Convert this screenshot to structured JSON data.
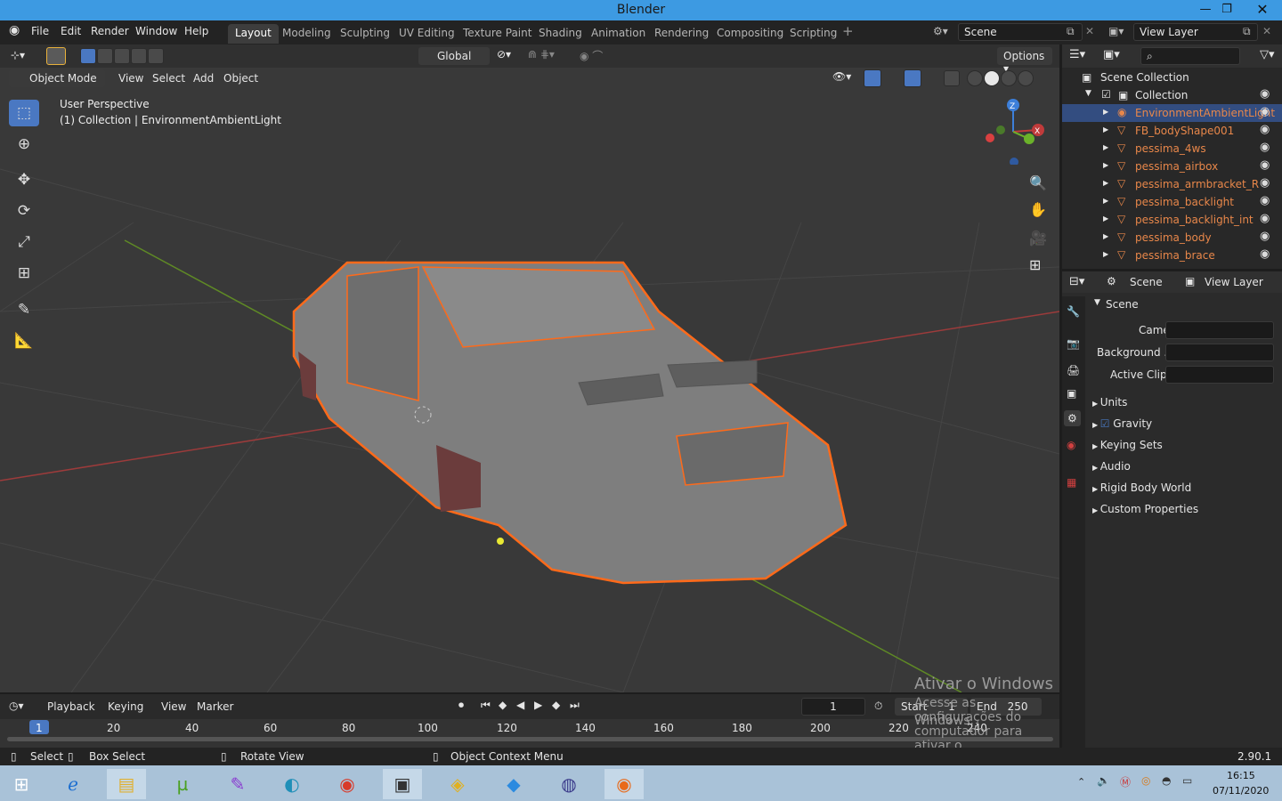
{
  "window": {
    "title": "Blender"
  },
  "menu": {
    "items": [
      "File",
      "Edit",
      "Render",
      "Window",
      "Help"
    ]
  },
  "workspaces": [
    "Layout",
    "Modeling",
    "Sculpting",
    "UV Editing",
    "Texture Paint",
    "Shading",
    "Animation",
    "Rendering",
    "Compositing",
    "Scripting"
  ],
  "active_workspace": "Layout",
  "scene": {
    "name": "Scene",
    "view_layer": "View Layer"
  },
  "toolbar": {
    "orientation": "Global",
    "options": "Options"
  },
  "header": {
    "mode": "Object Mode",
    "items": [
      "View",
      "Select",
      "Add",
      "Object"
    ]
  },
  "viewport": {
    "perspective": "User Perspective",
    "collection_info": "(1) Collection | EnvironmentAmbientLight"
  },
  "outliner": {
    "root": "Scene Collection",
    "collection": "Collection",
    "objects": [
      "EnvironmentAmbientLight",
      "FB_bodyShape001",
      "pessima_4ws",
      "pessima_airbox",
      "pessima_armbracket_R",
      "pessima_backlight",
      "pessima_backlight_int",
      "pessima_body",
      "pessima_brace"
    ]
  },
  "properties": {
    "tabs": {
      "scene": "Scene",
      "view_layer": "View Layer"
    },
    "panel_title": "Scene",
    "fields": [
      {
        "label": "Camera",
        "value": ""
      },
      {
        "label": "Background ...",
        "value": ""
      },
      {
        "label": "Active Clip",
        "value": ""
      }
    ],
    "sections": [
      "Units",
      "Gravity",
      "Keying Sets",
      "Audio",
      "Rigid Body World",
      "Custom Properties"
    ],
    "gravity_enabled": true
  },
  "timeline": {
    "menu": [
      "Playback",
      "Keying",
      "View",
      "Marker"
    ],
    "current_frame": "1",
    "start_label": "Start",
    "start": "1",
    "end_label": "End",
    "end": "250",
    "ruler": [
      "1",
      "20",
      "40",
      "60",
      "80",
      "100",
      "120",
      "140",
      "160",
      "180",
      "200",
      "220",
      "240"
    ]
  },
  "statusbar": {
    "select": "Select",
    "box_select": "Box Select",
    "rotate": "Rotate View",
    "context": "Object Context Menu",
    "version": "2.90.1"
  },
  "watermark": {
    "line1": "Ativar o Windows",
    "line2": "Acesse as configurações do computador para ativar o",
    "line3": "Windows."
  },
  "taskbar": {
    "time": "16:15",
    "date": "07/11/2020"
  },
  "colors": {
    "accent": "#e8874a",
    "selection": "#ff6a1a",
    "active_tab": "#3d3d3d",
    "titlebar": "#3d9ae2"
  }
}
